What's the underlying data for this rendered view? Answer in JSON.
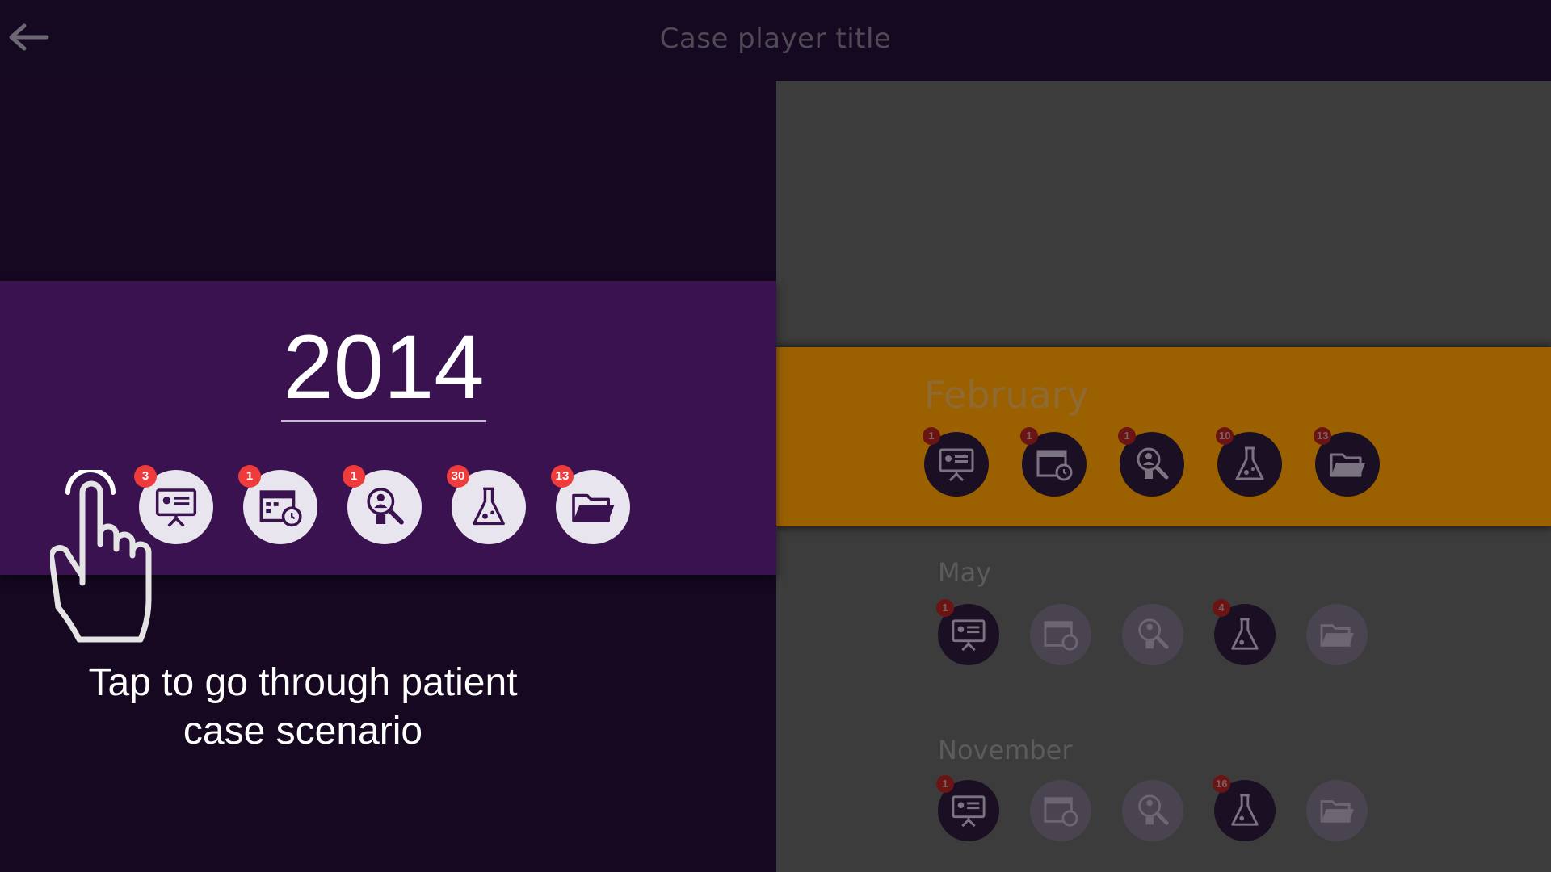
{
  "header": {
    "title": "Case player title",
    "back_icon": "back-arrow-icon"
  },
  "focus": {
    "year": "2014",
    "icons": [
      {
        "name": "presentation-icon",
        "badge": "3"
      },
      {
        "name": "calendar-clock-icon",
        "badge": "1"
      },
      {
        "name": "search-person-icon",
        "badge": "1"
      },
      {
        "name": "flask-icon",
        "badge": "30"
      },
      {
        "name": "folder-icon",
        "badge": "13"
      }
    ],
    "hint_line1": "Tap to go through patient",
    "hint_line2": "case scenario",
    "hand_icon": "tap-hand-icon"
  },
  "timeline": {
    "months": [
      {
        "label": "February",
        "badges": [
          "1",
          "1",
          "1",
          "10",
          "13"
        ]
      },
      {
        "label": "May",
        "badges": [
          "1",
          "",
          "",
          "4",
          ""
        ]
      },
      {
        "label": "November",
        "badges": [
          "1",
          "",
          "",
          "16",
          ""
        ]
      }
    ]
  },
  "colors": {
    "background": "#150820",
    "year_band": "#3b1250",
    "month_highlight": "#9b6100",
    "right_panel": "#3c3c3c",
    "badge": "#ee3b3b",
    "icon_circle": "#e9e5ee"
  }
}
